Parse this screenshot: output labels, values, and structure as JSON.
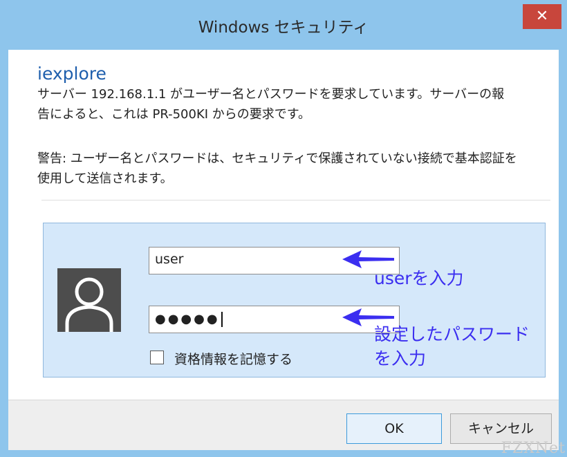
{
  "window": {
    "title": "Windows セキュリティ",
    "close_label": "✕"
  },
  "dialog": {
    "app_name": "iexplore",
    "message_line1": "サーバー 192.168.1.1 がユーザー名とパスワードを要求しています。サーバーの報",
    "message_line2": "告によると、これは PR-500KI からの要求です。",
    "warning_line1": "警告: ユーザー名とパスワードは、セキュリティで保護されていない接続で基本認証を",
    "warning_line2": "使用して送信されます。"
  },
  "login": {
    "username_value": "user",
    "password_value": "●●●●●",
    "remember_label": "資格情報を記憶する",
    "remember_checked": false
  },
  "annotations": {
    "user_hint": "userを入力",
    "password_hint_line1": "設定したパスワード",
    "password_hint_line2": "を入力"
  },
  "buttons": {
    "ok_label": "OK",
    "cancel_label": "キャンセル"
  },
  "watermark": "FZXNet",
  "colors": {
    "frame": "#8ec5ec",
    "close_button": "#c8463c",
    "app_name": "#1f5fad",
    "login_panel": "#d5e8fa",
    "annotation": "#3b2ef0"
  }
}
